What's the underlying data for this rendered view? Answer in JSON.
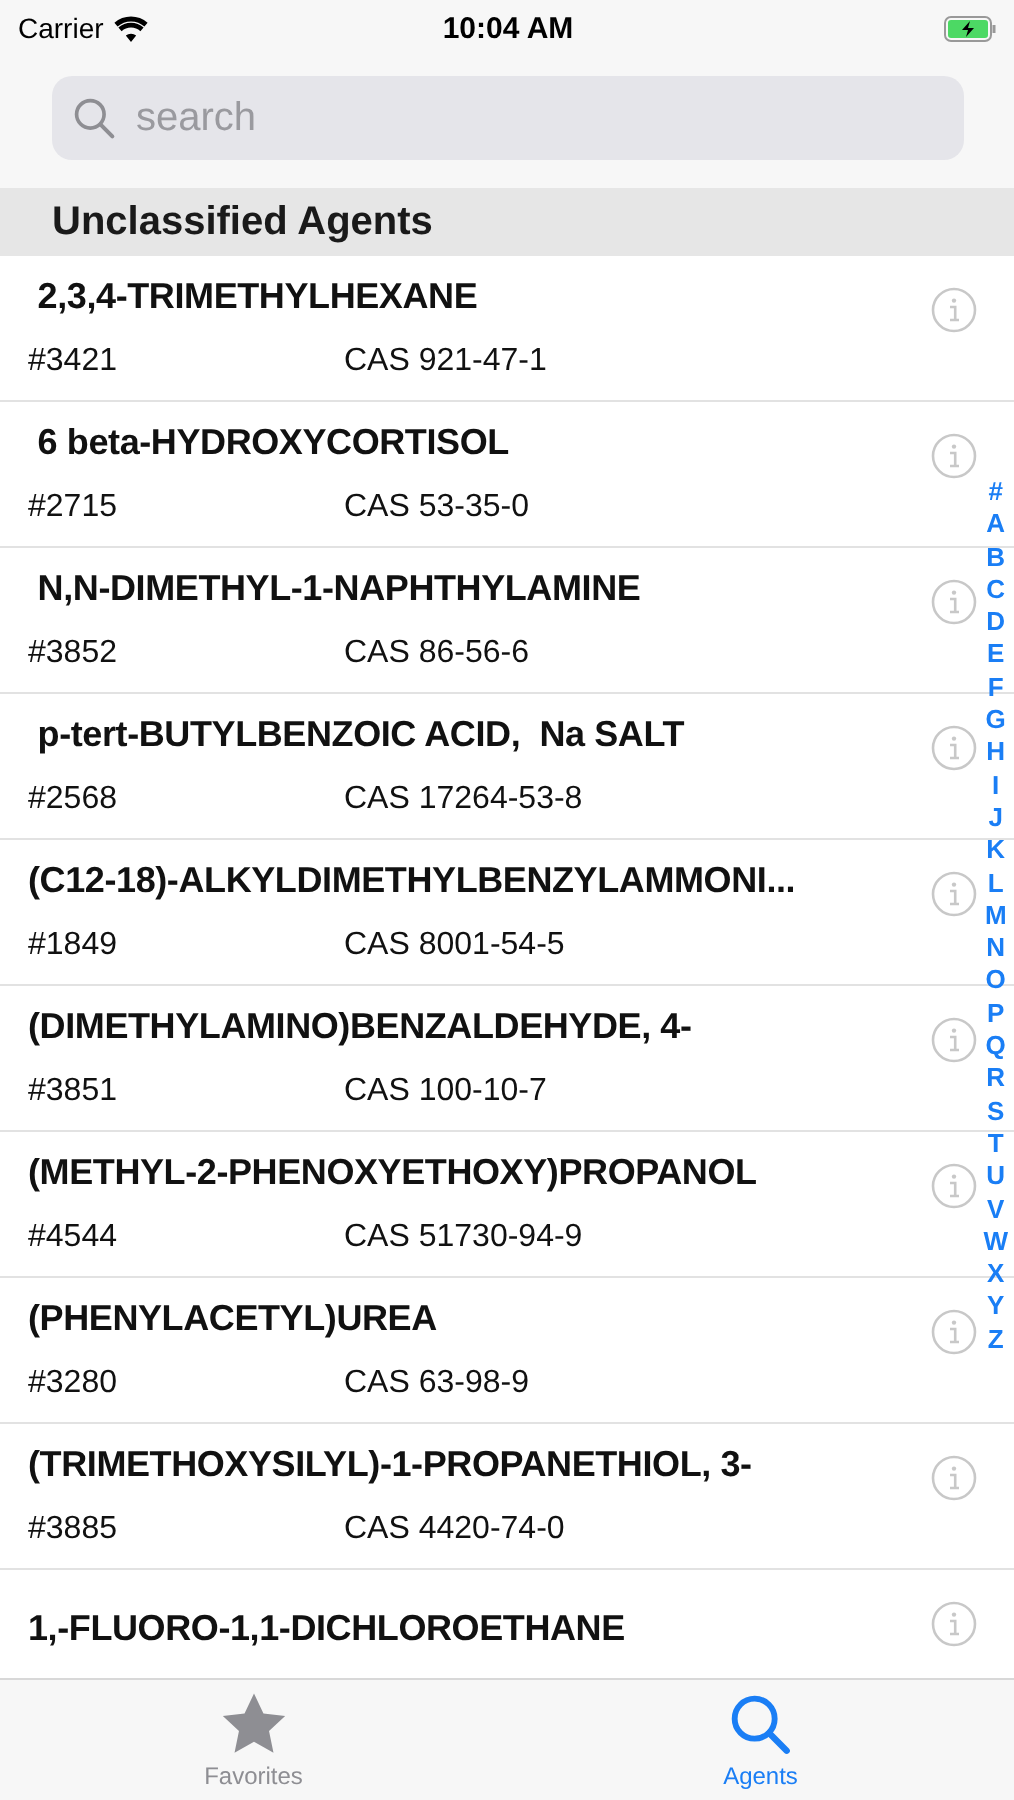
{
  "status_bar": {
    "carrier": "Carrier",
    "time": "10:04 AM"
  },
  "search": {
    "placeholder": "search"
  },
  "section": {
    "title": "Unclassified Agents"
  },
  "agents": [
    {
      "name": " 2,3,4-TRIMETHYLHEXANE",
      "number": "#3421",
      "cas": "CAS 921-47-1"
    },
    {
      "name": " 6 beta-HYDROXYCORTISOL",
      "number": "#2715",
      "cas": "CAS 53-35-0"
    },
    {
      "name": " N,N-DIMETHYL-1-NAPHTHYLAMINE",
      "number": "#3852",
      "cas": "CAS 86-56-6"
    },
    {
      "name": " p-tert-BUTYLBENZOIC ACID,  Na SALT",
      "number": "#2568",
      "cas": "CAS 17264-53-8"
    },
    {
      "name": "(C12-18)-ALKYLDIMETHYLBENZYLAMMONI...",
      "number": "#1849",
      "cas": "CAS 8001-54-5"
    },
    {
      "name": "(DIMETHYLAMINO)BENZALDEHYDE, 4-",
      "number": "#3851",
      "cas": "CAS 100-10-7"
    },
    {
      "name": "(METHYL-2-PHENOXYETHOXY)PROPANOL",
      "number": "#4544",
      "cas": "CAS 51730-94-9"
    },
    {
      "name": "(PHENYLACETYL)UREA",
      "number": "#3280",
      "cas": "CAS 63-98-9"
    },
    {
      "name": "(TRIMETHOXYSILYL)-1-PROPANETHIOL, 3-",
      "number": "#3885",
      "cas": "CAS 4420-74-0"
    },
    {
      "name": "1,-FLUORO-1,1-DICHLOROETHANE"
    }
  ],
  "index": [
    "#",
    "A",
    "B",
    "C",
    "D",
    "E",
    "F",
    "G",
    "H",
    "I",
    "J",
    "K",
    "L",
    "M",
    "N",
    "O",
    "P",
    "Q",
    "R",
    "S",
    "T",
    "U",
    "V",
    "W",
    "X",
    "Y",
    "Z"
  ],
  "tabs": [
    {
      "label": "Favorites",
      "kind": "star",
      "selected": false
    },
    {
      "label": "Agents",
      "kind": "search",
      "selected": true
    }
  ]
}
